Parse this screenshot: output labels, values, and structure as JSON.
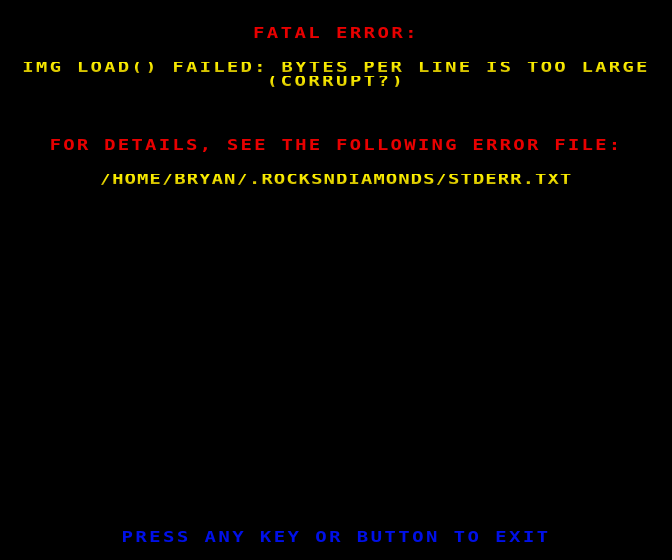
{
  "screen": {
    "type": "fatal-error-screen",
    "colors": {
      "background": "#000000",
      "title": "#e80000",
      "message": "#f4e400",
      "hint": "#0010e8"
    }
  },
  "error": {
    "title": "FATAL ERROR:",
    "message_line1": "IMG_LOAD() FAILED: BYTES PER LINE IS TOO LARGE",
    "message_line2": "(CORRUPT?)",
    "details_label": "FOR DETAILS, SEE THE FOLLOWING ERROR FILE:",
    "error_file_path": "/HOME/BRYAN/.ROCKSNDIAMONDS/STDERR.TXT"
  },
  "footer": {
    "exit_prompt": "PRESS ANY KEY OR BUTTON TO EXIT"
  }
}
